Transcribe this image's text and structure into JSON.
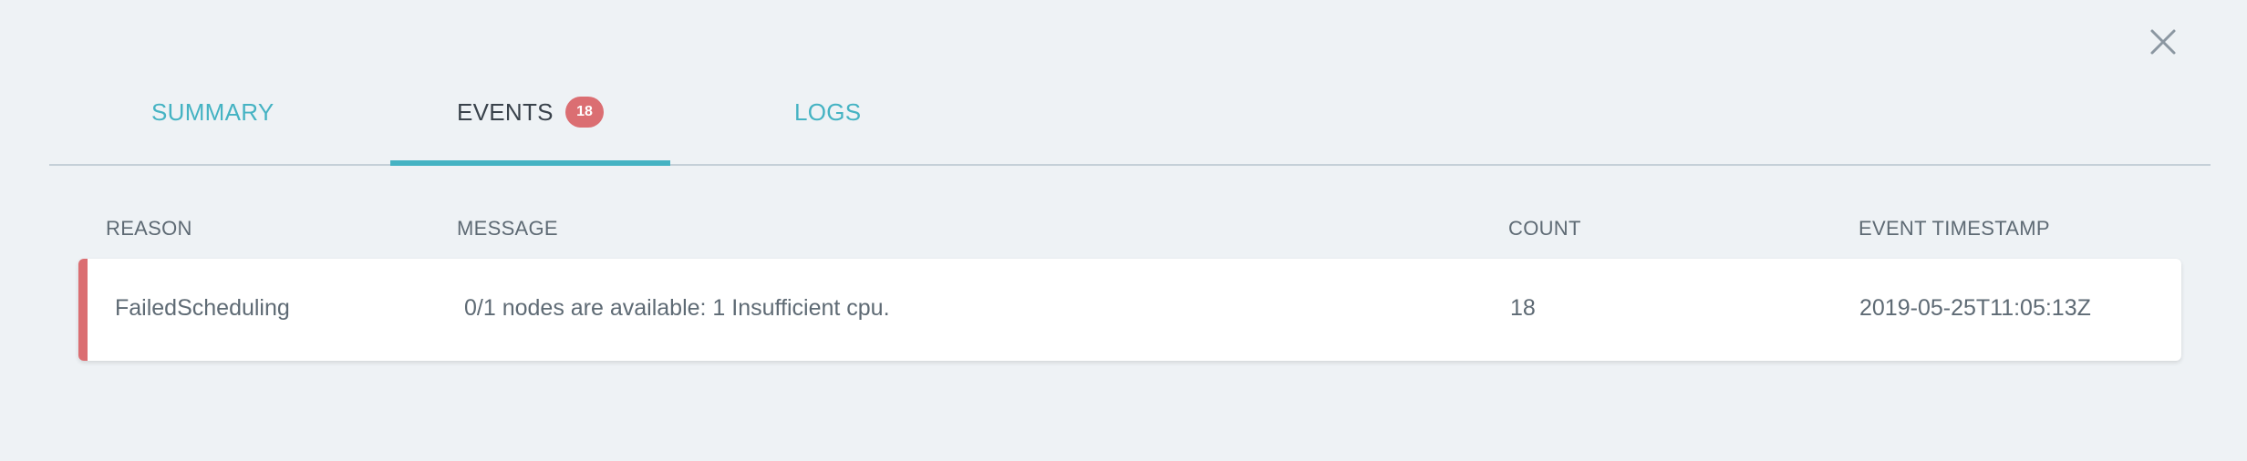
{
  "tabs": [
    {
      "label": "SUMMARY",
      "active": false
    },
    {
      "label": "EVENTS",
      "active": true,
      "badge": "18"
    },
    {
      "label": "LOGS",
      "active": false
    }
  ],
  "table": {
    "columns": [
      "REASON",
      "MESSAGE",
      "COUNT",
      "EVENT TIMESTAMP"
    ],
    "rows": [
      {
        "reason": "FailedScheduling",
        "message": "0/1 nodes are available: 1 Insufficient cpu.",
        "count": "18",
        "timestamp": "2019-05-25T11:05:13Z",
        "severity": "error"
      }
    ]
  },
  "icons": {
    "close": "close-icon"
  },
  "colors": {
    "accent": "#45b3c3",
    "error": "#db6e72",
    "background": "#eef2f5",
    "text": "#5e6a74"
  }
}
